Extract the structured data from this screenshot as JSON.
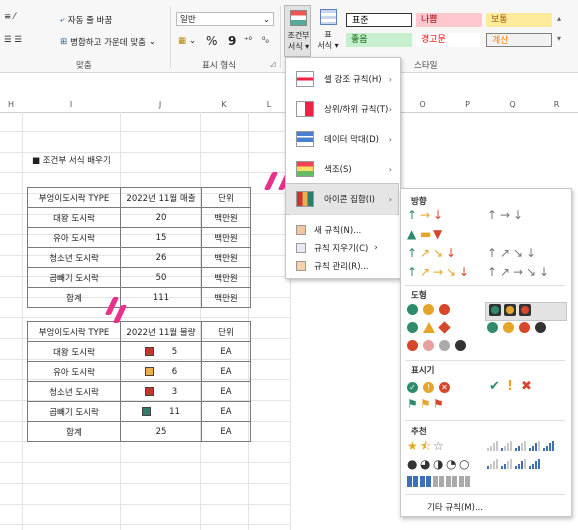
{
  "ribbon": {
    "wrap_text": "자동 줄 바꿈",
    "merge_center": "병합하고 가운데 맞춤",
    "alignment_group": "맞춤",
    "number_format_value": "일반",
    "percent": "%",
    "comma": "9",
    "number_group": "표시 형식",
    "cond_format": "조건부\n서식",
    "cond_format_l1": "조건부",
    "cond_format_l2": "서식 ▾",
    "table_format_l1": "표",
    "table_format_l2": "서식 ▾",
    "styles_group": "스타일",
    "styles": [
      {
        "label": "표준",
        "bg": "#ffffff",
        "fg": "#000000",
        "border": "#333333"
      },
      {
        "label": "나쁨",
        "bg": "#ffc7ce",
        "fg": "#9c0006"
      },
      {
        "label": "보통",
        "bg": "#ffeb9c",
        "fg": "#9c5700"
      },
      {
        "label": "좋음",
        "bg": "#c6efce",
        "fg": "#006100"
      },
      {
        "label": "경고문",
        "bg": "#ffffff",
        "fg": "#ff0000"
      },
      {
        "label": "계산",
        "bg": "#f2f2f2",
        "fg": "#fa7d00",
        "border": "#7f7f7f"
      }
    ]
  },
  "columns": [
    "H",
    "I",
    "J",
    "K",
    "L",
    "O",
    "P",
    "Q",
    "R"
  ],
  "sheet": {
    "title": "■ 조건부 서식 배우기",
    "table1": {
      "headers": [
        "부엉이도시락 TYPE",
        "2022년 11월 매출",
        "단위"
      ],
      "rows": [
        [
          "대왕 도시락",
          "20",
          "백만원"
        ],
        [
          "유아 도시락",
          "15",
          "백만원"
        ],
        [
          "청소년 도시락",
          "26",
          "백만원"
        ],
        [
          "곱빼기 도시락",
          "50",
          "백만원"
        ],
        [
          "합계",
          "111",
          "백만원"
        ]
      ]
    },
    "table2": {
      "headers": [
        "부엉이도시락 TYPE",
        "2022년 11월 불량",
        "단위"
      ],
      "rows": [
        [
          "대왕 도시락",
          "5",
          "EA"
        ],
        [
          "유아 도시락",
          "6",
          "EA"
        ],
        [
          "청소년 도시락",
          "3",
          "EA"
        ],
        [
          "곱빼기 도시락",
          "11",
          "EA"
        ],
        [
          "합계",
          "25",
          "EA"
        ]
      ],
      "icon_colors": [
        "#c0392b",
        "#e8b04a",
        "#c0392b",
        "#2e7d6b",
        ""
      ]
    }
  },
  "menu": {
    "items": [
      {
        "label": "셀 강조 규칙(H)",
        "icon": "highlight-cells-icon"
      },
      {
        "label": "상위/하위 규칙(T)",
        "icon": "top-bottom-icon"
      },
      {
        "label": "데이터 막대(D)",
        "icon": "data-bars-icon"
      },
      {
        "label": "색조(S)",
        "icon": "color-scales-icon"
      },
      {
        "label": "아이콘 집합(I)",
        "icon": "icon-sets-icon"
      }
    ],
    "small_items": [
      {
        "label": "새 규칙(N)...",
        "icon": "new-rule-icon"
      },
      {
        "label": "규칙 지우기(C)",
        "icon": "clear-rules-icon"
      },
      {
        "label": "규칙 관리(R)...",
        "icon": "manage-rules-icon"
      }
    ]
  },
  "submenu": {
    "sections": [
      "방향",
      "도형",
      "표시기",
      "추천"
    ],
    "more_rules": "기타 규칙(M)..."
  }
}
